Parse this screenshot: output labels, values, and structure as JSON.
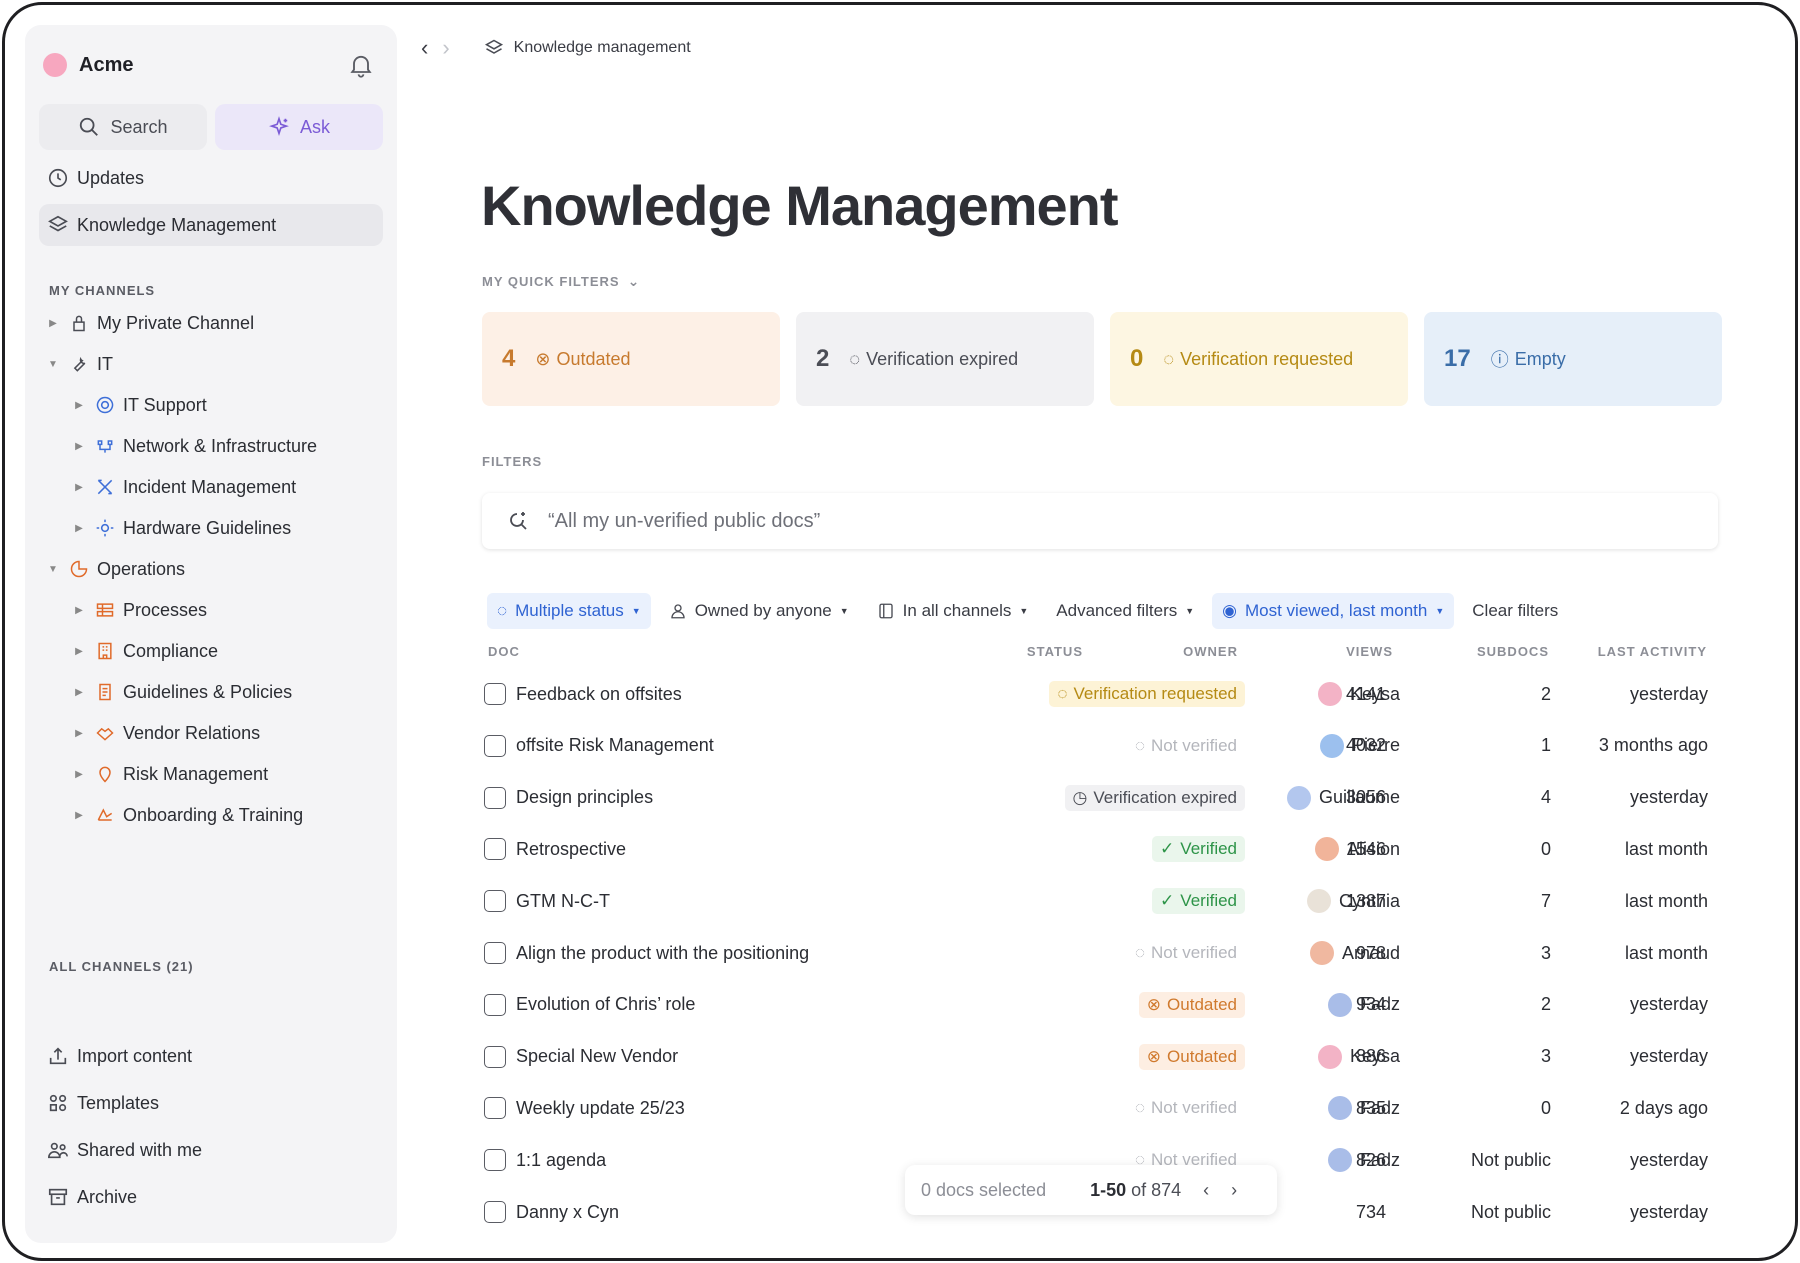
{
  "workspace": {
    "name": "Acme"
  },
  "sidebar": {
    "search_label": "Search",
    "ask_label": "Ask",
    "updates_label": "Updates",
    "km_label": "Knowledge Management",
    "my_channels_label": "MY CHANNELS",
    "channels": [
      {
        "label": "My Private Channel",
        "icon": "lock-icon",
        "level": 0,
        "caret": "right"
      },
      {
        "label": "IT",
        "icon": "wrench-icon",
        "level": 0,
        "caret": "down"
      },
      {
        "label": "IT Support",
        "icon": "lifebuoy-icon",
        "level": 1,
        "caret": "right"
      },
      {
        "label": "Network & Infrastructure",
        "icon": "network-icon",
        "level": 1,
        "caret": "right"
      },
      {
        "label": "Incident Management",
        "icon": "tools-icon",
        "level": 1,
        "caret": "right"
      },
      {
        "label": "Hardware Guidelines",
        "icon": "gear-icon",
        "level": 1,
        "caret": "right"
      },
      {
        "label": "Operations",
        "icon": "chart-icon",
        "level": 0,
        "caret": "down"
      },
      {
        "label": "Processes",
        "icon": "process-icon",
        "level": 1,
        "caret": "right"
      },
      {
        "label": "Compliance",
        "icon": "building-icon",
        "level": 1,
        "caret": "right"
      },
      {
        "label": "Guidelines & Policies",
        "icon": "scroll-icon",
        "level": 1,
        "caret": "right"
      },
      {
        "label": "Vendor Relations",
        "icon": "handshake-icon",
        "level": 1,
        "caret": "right"
      },
      {
        "label": "Risk Management",
        "icon": "pin-icon",
        "level": 1,
        "caret": "right"
      },
      {
        "label": "Onboarding & Training",
        "icon": "training-icon",
        "level": 1,
        "caret": "right"
      }
    ],
    "all_channels_label": "ALL CHANNELS (21)",
    "import_label": "Import content",
    "templates_label": "Templates",
    "shared_label": "Shared with me",
    "archive_label": "Archive"
  },
  "breadcrumb": {
    "label": "Knowledge management"
  },
  "page": {
    "title": "Knowledge Management"
  },
  "quick_filters": {
    "label": "MY QUICK FILTERS",
    "cards": [
      {
        "count": "4",
        "label": "Outdated"
      },
      {
        "count": "2",
        "label": "Verification expired"
      },
      {
        "count": "0",
        "label": "Verification requested"
      },
      {
        "count": "17",
        "label": "Empty"
      }
    ]
  },
  "filters": {
    "label": "FILTERS",
    "search_placeholder": "“All my un-verified public docs”",
    "chips": {
      "status": "Multiple status",
      "owner": "Owned by anyone",
      "channels": "In all channels",
      "advanced": "Advanced filters",
      "sort": "Most viewed, last month",
      "clear": "Clear filters"
    }
  },
  "table": {
    "headers": {
      "doc": "DOC",
      "status": "STATUS",
      "owner": "OWNER",
      "views": "VIEWS",
      "subdocs": "SUBDOCS",
      "last": "LAST ACTIVITY"
    },
    "rows": [
      {
        "doc": "Feedback on offsites",
        "status": "Verification requested",
        "owner": "Keysa",
        "views": "4141",
        "subdocs": "2",
        "last": "yesterday"
      },
      {
        "doc": "offsite Risk Management",
        "status": "Not verified",
        "owner": "Pierre",
        "views": "4032",
        "subdocs": "1",
        "last": "3 months ago"
      },
      {
        "doc": "Design principles",
        "status": "Verification expired",
        "owner": "Guillaume",
        "views": "3056",
        "subdocs": "4",
        "last": "yesterday"
      },
      {
        "doc": "Retrospective",
        "status": "Verified",
        "owner": "Alision",
        "views": "1546",
        "subdocs": "0",
        "last": "last month"
      },
      {
        "doc": "GTM N-C-T",
        "status": "Verified",
        "owner": "Cynthia",
        "views": "1387",
        "subdocs": "7",
        "last": "last month"
      },
      {
        "doc": "Align the product with the positioning",
        "status": "Not verified",
        "owner": "Arnaud",
        "views": "978",
        "subdocs": "3",
        "last": "last month"
      },
      {
        "doc": "Evolution of Chris’ role",
        "status": "Outdated",
        "owner": "Fadz",
        "views": "934",
        "subdocs": "2",
        "last": "yesterday"
      },
      {
        "doc": "Special New Vendor",
        "status": "Outdated",
        "owner": "Keysa",
        "views": "886",
        "subdocs": "3",
        "last": "yesterday"
      },
      {
        "doc": "Weekly update 25/23",
        "status": "Not verified",
        "owner": "Fadz",
        "views": "835",
        "subdocs": "0",
        "last": "2 days ago"
      },
      {
        "doc": "1:1 agenda",
        "status": "Not verified",
        "owner": "Fadz",
        "views": "826",
        "subdocs": "Not public",
        "last": "yesterday"
      },
      {
        "doc": "Danny x Cyn",
        "status": "",
        "owner": "",
        "views": "734",
        "subdocs": "Not public",
        "last": "yesterday"
      }
    ]
  },
  "pager": {
    "selected": "0 docs selected",
    "range": "1-50",
    "of": "of 874"
  }
}
